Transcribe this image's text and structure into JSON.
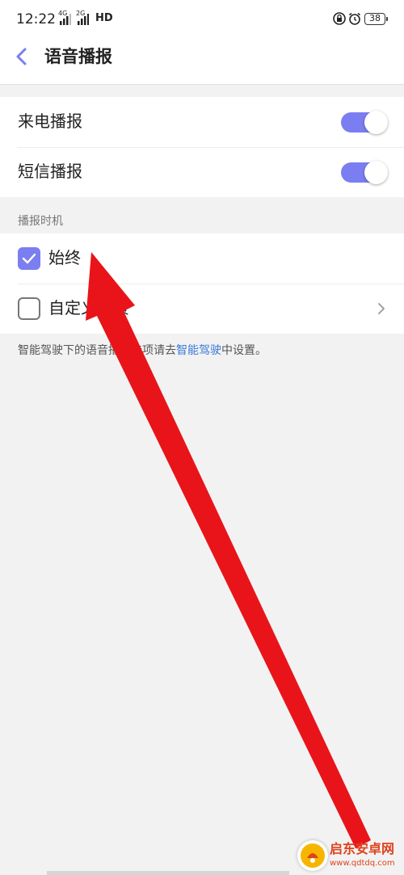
{
  "status_bar": {
    "time": "12:22",
    "signal_1_label": "4G",
    "signal_2_label": "2G",
    "network_badge": "HD",
    "battery_level": "38",
    "icons": [
      "signal-icon",
      "signal-icon",
      "hd-icon",
      "lock-rotation-icon",
      "alarm-icon",
      "battery-icon"
    ]
  },
  "header": {
    "back_icon": "chevron-left-icon",
    "title": "语音播报"
  },
  "broadcast_settings": [
    {
      "label": "来电播报",
      "enabled": true
    },
    {
      "label": "短信播报",
      "enabled": true
    }
  ],
  "timing_section": {
    "header": "播报时机",
    "options": [
      {
        "label": "始终",
        "checked": true
      },
      {
        "label": "自定义场景",
        "checked": false
      }
    ]
  },
  "footnote": {
    "prefix": "智能驾驶下的语音播报选项请去",
    "link": "智能驾驶",
    "suffix": "中设置。"
  },
  "colors": {
    "accent": "#7b7ef0",
    "link": "#3a7ad8",
    "annotation_arrow": "#e8141a",
    "background": "#f2f2f2"
  },
  "watermark": {
    "title": "启东安卓网",
    "url": "www.qdtdq.com"
  }
}
